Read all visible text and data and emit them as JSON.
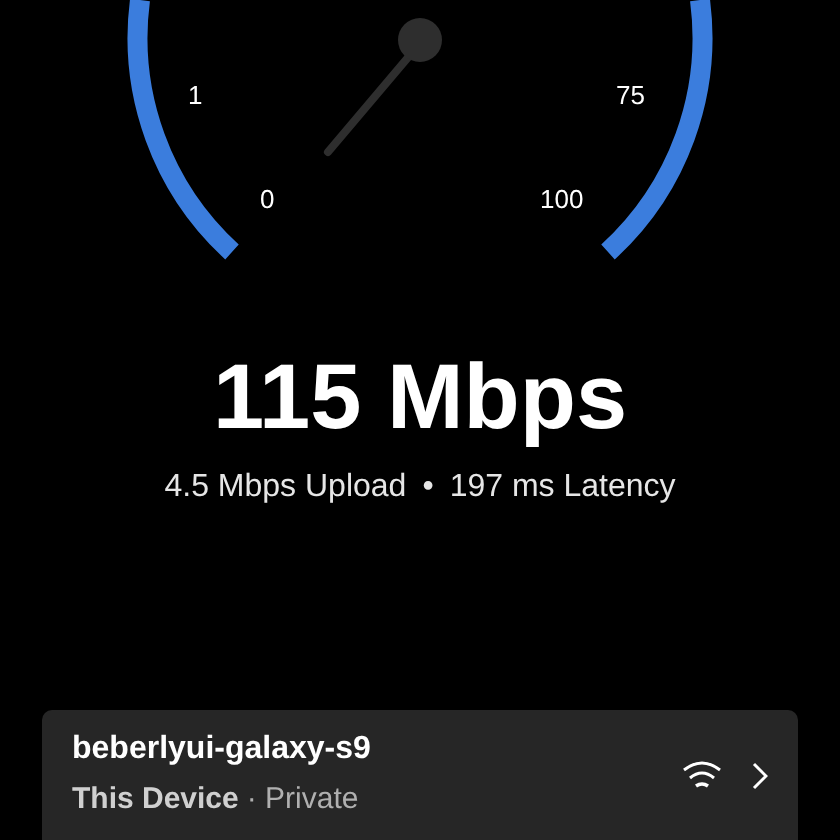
{
  "gauge": {
    "labels": [
      "1",
      "75",
      "0",
      "100"
    ]
  },
  "speed": "115 Mbps",
  "upload": "4.5 Mbps Upload",
  "separator": "•",
  "latency": "197 ms Latency",
  "device_card": {
    "name": "beberlyui-galaxy-s9",
    "device": "This Device",
    "network": "· Private"
  }
}
